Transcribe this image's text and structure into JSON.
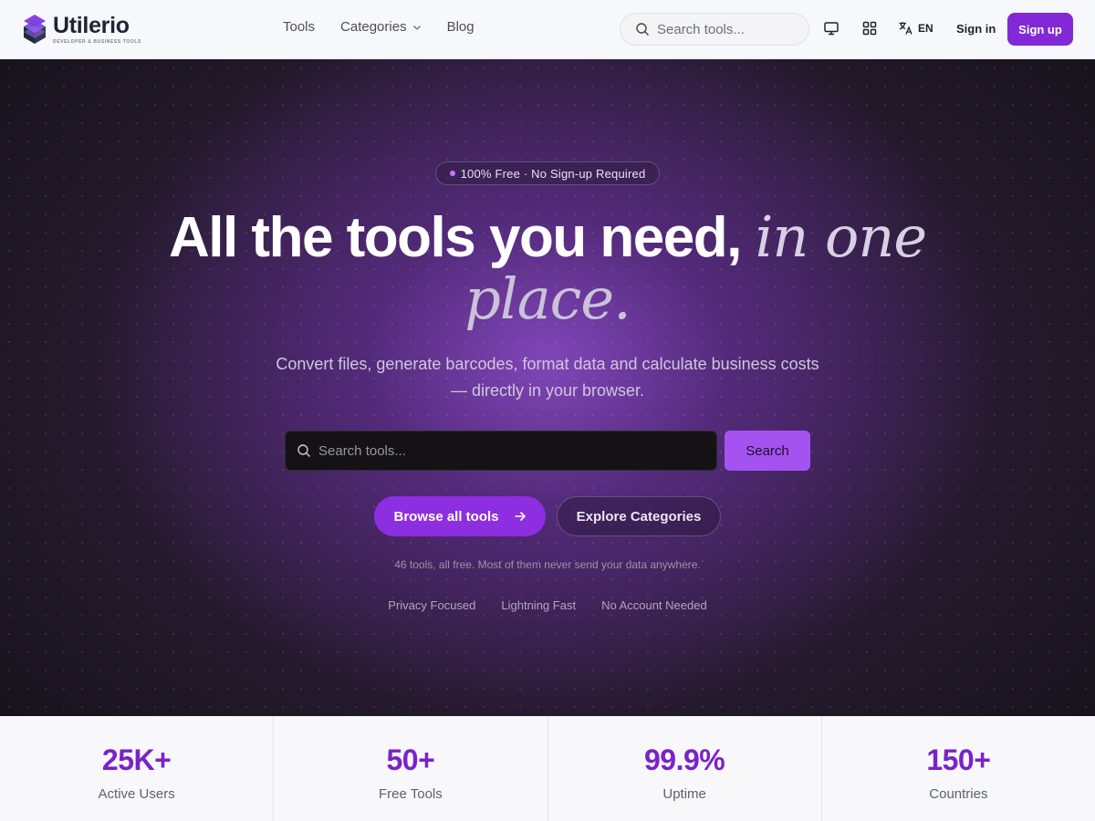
{
  "header": {
    "logo": {
      "name": "Utilerio",
      "tagline": "DEVELOPER & BUSINESS TOOLS"
    },
    "nav": [
      {
        "label": "Tools"
      },
      {
        "label": "Categories"
      },
      {
        "label": "Blog"
      }
    ],
    "search": {
      "placeholder": "Search tools..."
    },
    "language": "EN",
    "signin_label": "Sign in",
    "signup_label": "Sign up"
  },
  "hero": {
    "badge": "100% Free · No Sign-up Required",
    "headline_main": "All the tools you need, ",
    "headline_italic_1": "in one",
    "headline_italic_2": "place.",
    "subtitle": "Convert files, generate barcodes, format data and calculate business costs — directly in your browser.",
    "search": {
      "placeholder": "Search tools...",
      "button_label": "Search"
    },
    "browse_label": "Browse all tools",
    "explore_label": "Explore Categories",
    "note": "46 tools, all free. Most of them never send your data anywhere.",
    "features": [
      "Privacy Focused",
      "Lightning Fast",
      "No Account Needed"
    ]
  },
  "stats": [
    {
      "value": "25K+",
      "label": "Active Users"
    },
    {
      "value": "50+",
      "label": "Free Tools"
    },
    {
      "value": "99.9%",
      "label": "Uptime"
    },
    {
      "value": "150+",
      "label": "Countries"
    }
  ],
  "colors": {
    "brand": "#8228d6",
    "accent": "#a553f0",
    "stat": "#7a22c8"
  }
}
